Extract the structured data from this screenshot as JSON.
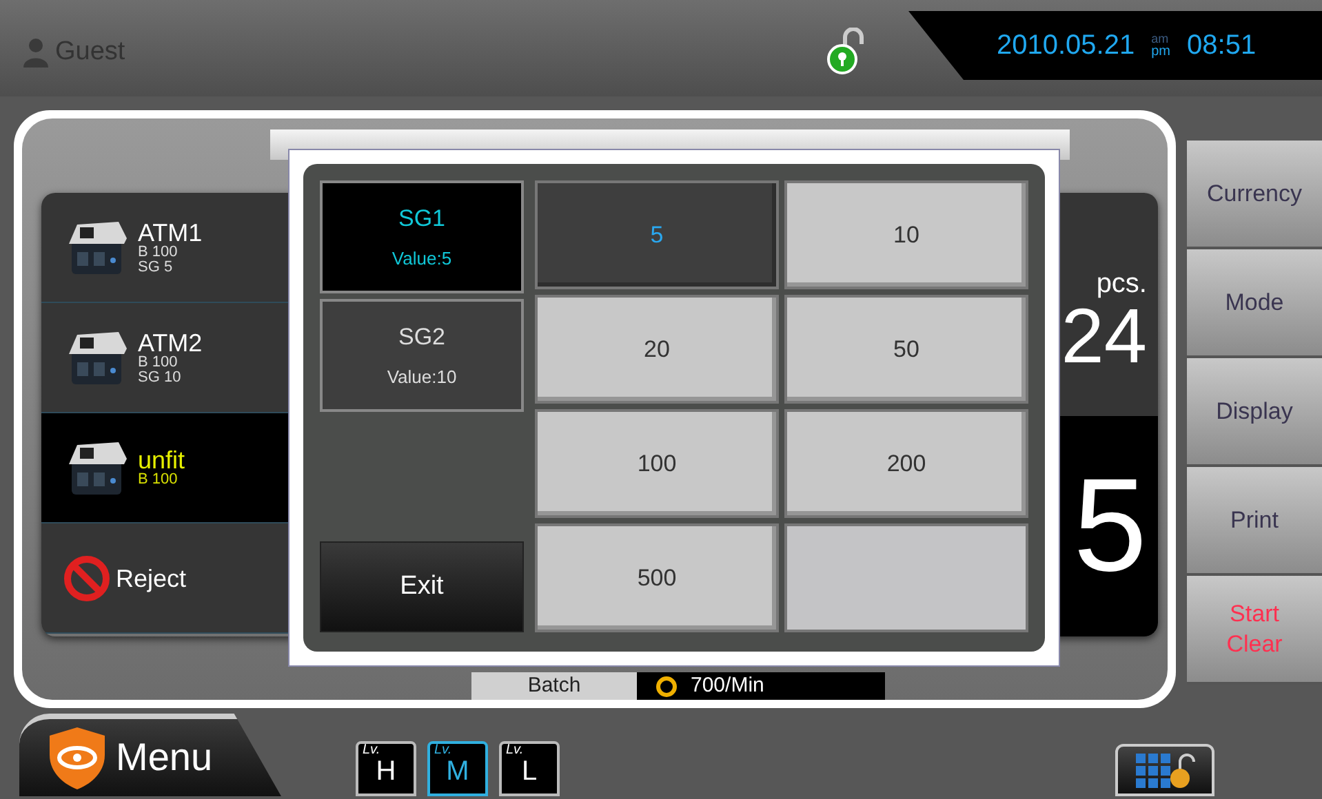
{
  "header": {
    "user": "Guest",
    "locked": false,
    "date": "2010.05.21",
    "am": "am",
    "pm": "pm",
    "time": "08:51"
  },
  "pockets": [
    {
      "kind": "device",
      "name": "ATM1",
      "lines": [
        "B 100",
        "SG 5"
      ],
      "highlight": false
    },
    {
      "kind": "device",
      "name": "ATM2",
      "lines": [
        "B 100",
        "SG 10"
      ],
      "highlight": false
    },
    {
      "kind": "device",
      "name": "unfit",
      "lines": [
        "B 100"
      ],
      "highlight": true
    },
    {
      "kind": "reject",
      "name": "Reject",
      "highlight": false
    }
  ],
  "counter": {
    "unit": "pcs.",
    "count": "24",
    "value": "5"
  },
  "speed": {
    "mode": "Batch",
    "rate": "700/Min"
  },
  "side_buttons": [
    {
      "lines": [
        "Currency"
      ],
      "kind": "normal"
    },
    {
      "lines": [
        "Mode"
      ],
      "kind": "normal"
    },
    {
      "lines": [
        "Display"
      ],
      "kind": "normal"
    },
    {
      "lines": [
        "Print"
      ],
      "kind": "normal"
    },
    {
      "lines": [
        "Start",
        "Clear"
      ],
      "kind": "danger"
    }
  ],
  "menu": {
    "label": "Menu"
  },
  "levels": [
    {
      "prefix": "Lv.",
      "label": "H",
      "selected": false
    },
    {
      "prefix": "Lv.",
      "label": "M",
      "selected": true
    },
    {
      "prefix": "Lv.",
      "label": "L",
      "selected": false
    }
  ],
  "dialog": {
    "groups": [
      {
        "name": "SG1",
        "value": "Value:5",
        "selected": true
      },
      {
        "name": "SG2",
        "value": "Value:10",
        "selected": false
      }
    ],
    "denominations": [
      {
        "label": "5",
        "selected": true
      },
      {
        "label": "10",
        "selected": false
      },
      {
        "label": "20",
        "selected": false
      },
      {
        "label": "50",
        "selected": false
      },
      {
        "label": "100",
        "selected": false
      },
      {
        "label": "200",
        "selected": false
      },
      {
        "label": "500",
        "selected": false
      }
    ],
    "exit": "Exit"
  }
}
